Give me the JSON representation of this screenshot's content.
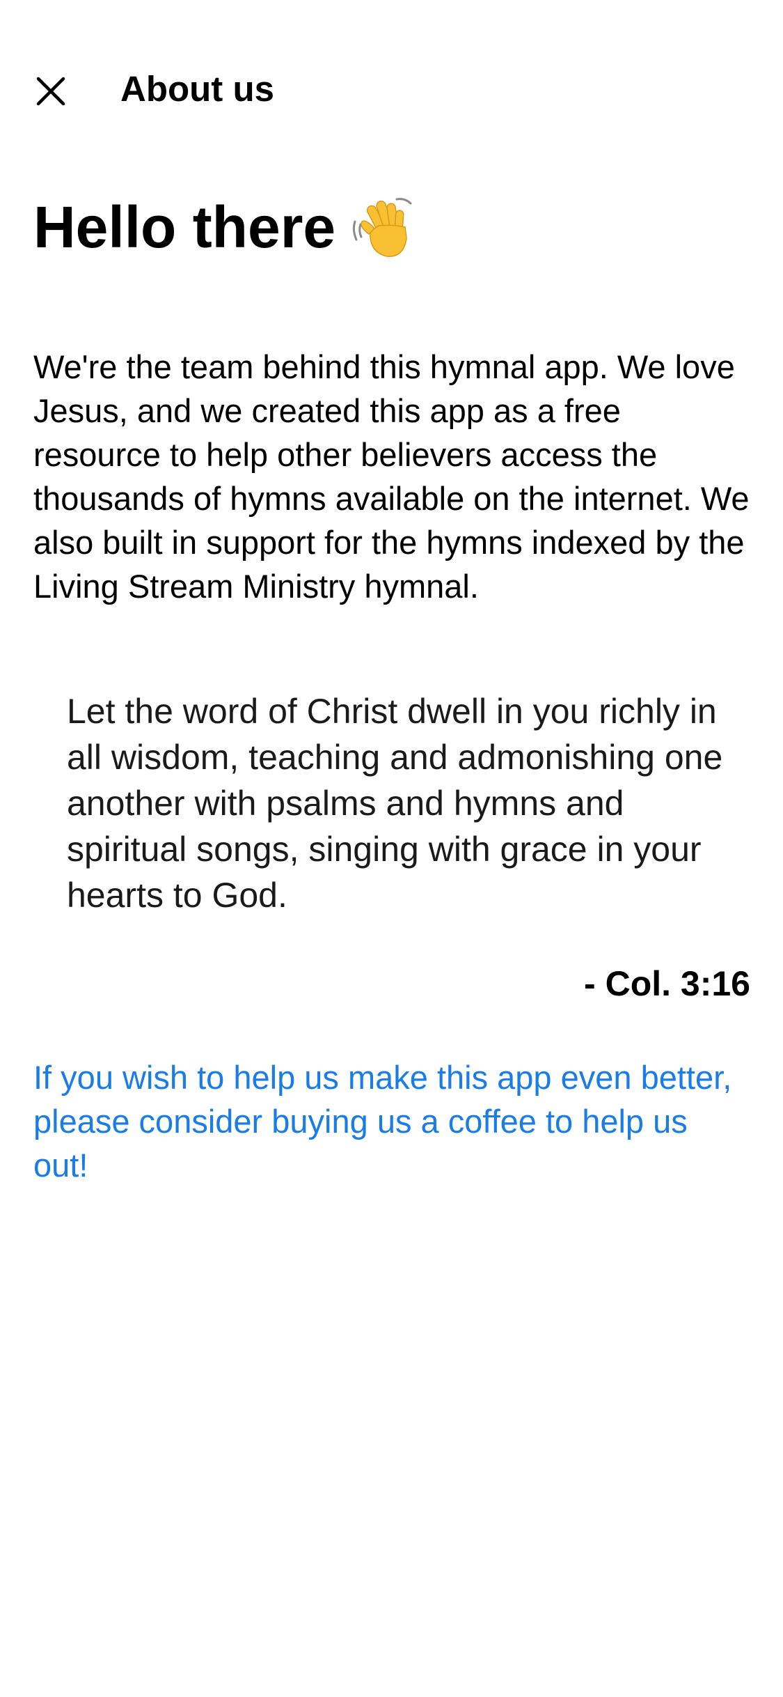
{
  "header": {
    "title": "About us",
    "close_icon": "close-icon"
  },
  "main": {
    "greeting": "Hello there",
    "greeting_icon": "waving-hand-icon",
    "intro": "We're the team behind this hymnal app. We love Jesus, and we created this app as a free resource to help other believers access the thousands of hymns available on the internet. We also built in support for the hymns indexed by the Living Stream Ministry hymnal.",
    "verse": "Let the word of Christ dwell in you richly in all wisdom, teaching and admonishing one another with psalms and hymns and spiritual songs, singing with grace in your hearts to God.",
    "verse_reference": "- Col. 3:16",
    "support_link": "If you wish to help us make this app even better, please consider buying us a coffee to help us out!"
  },
  "colors": {
    "link": "#1a7ce6",
    "text": "#000000",
    "background": "#ffffff"
  }
}
